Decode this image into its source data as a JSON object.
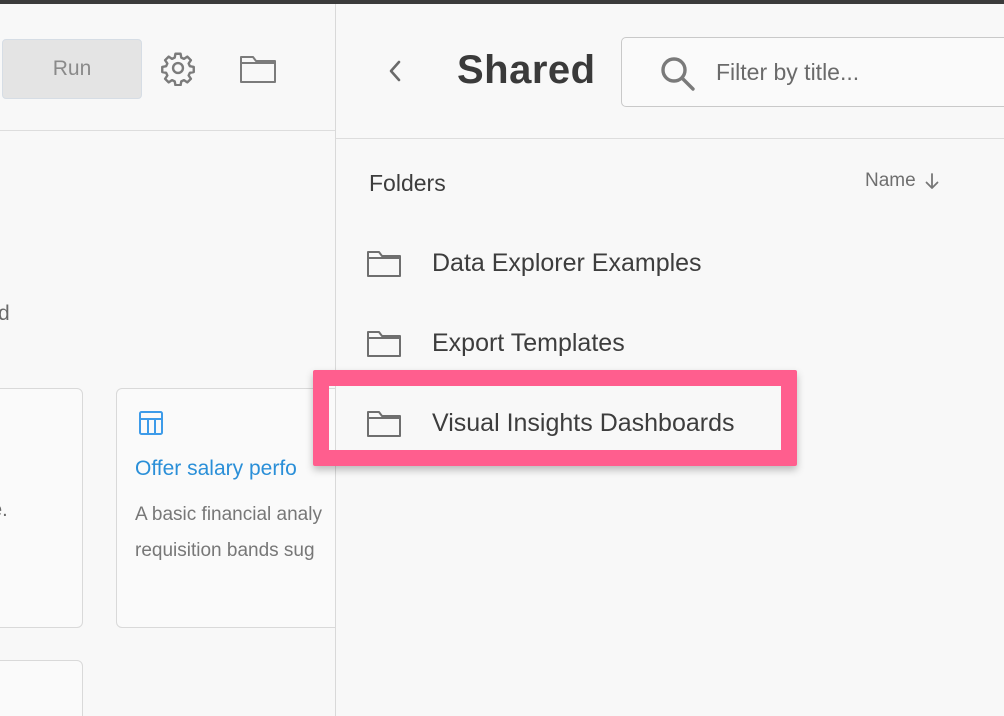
{
  "toolbar": {
    "run_label": "Run",
    "icons": [
      "gear-icon",
      "folder-icon"
    ]
  },
  "left_panel": {
    "fragment_d": "d",
    "fragment_e": "e.",
    "card": {
      "icon": "table-icon",
      "title": "Offer salary perfo",
      "desc_line1": "A basic financial analy",
      "desc_line2": "requisition bands sug"
    }
  },
  "right_panel": {
    "title": "Shared",
    "back_icon": "chevron-left-icon",
    "search": {
      "placeholder": "Filter by title...",
      "value": ""
    },
    "section_label": "Folders",
    "sort": {
      "label": "Name",
      "direction_icon": "arrow-down-icon"
    },
    "folders": [
      {
        "label": "Data Explorer Examples",
        "icon": "folder-icon"
      },
      {
        "label": "Export Templates",
        "icon": "folder-icon"
      },
      {
        "label": "Visual Insights Dashboards",
        "icon": "folder-icon",
        "highlighted": true
      }
    ]
  },
  "colors": {
    "highlight": "#ff5e8e",
    "link": "#2a8fd8",
    "background": "#f8f8f8",
    "top_bar": "#3b3b3b"
  }
}
